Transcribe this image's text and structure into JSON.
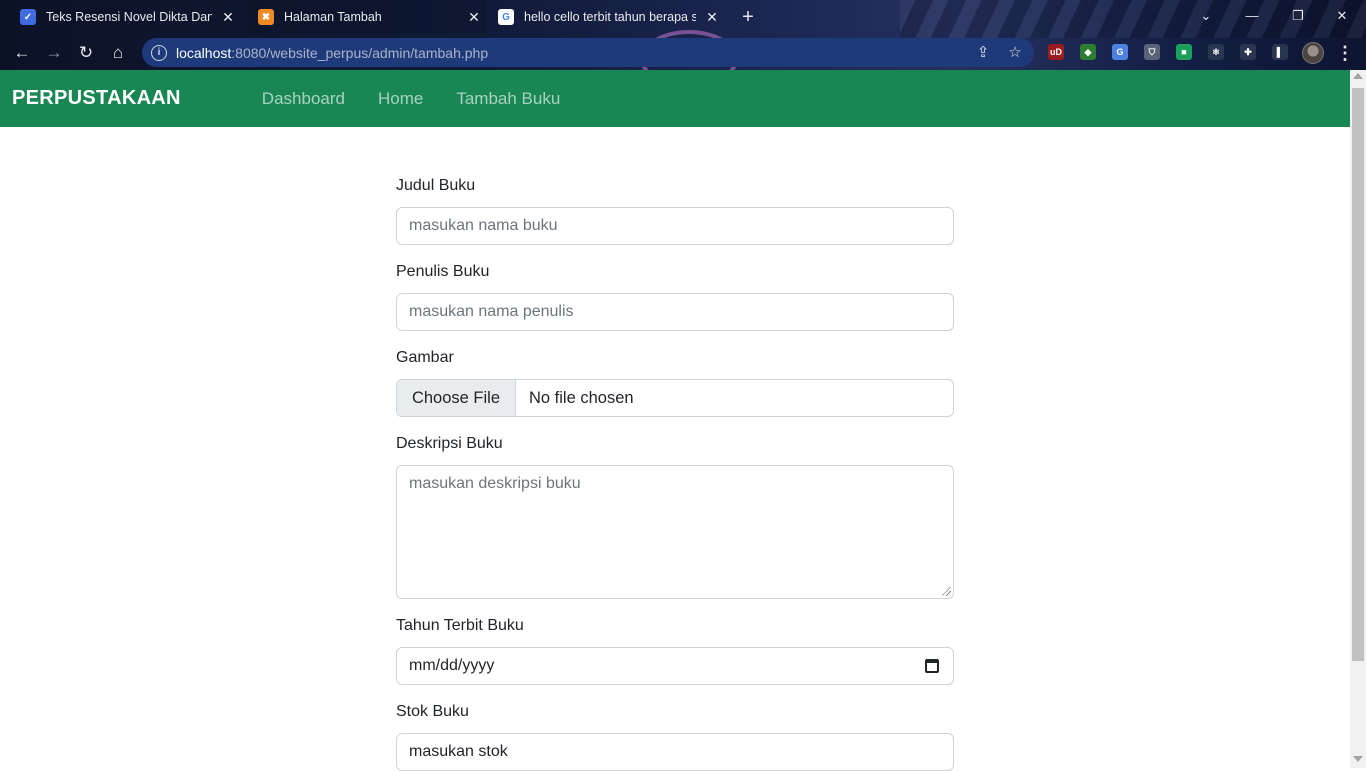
{
  "browser": {
    "tabs": [
      {
        "title": "Teks Resensi Novel Dikta Dan Hukum",
        "icon": "tab-favicon-blue"
      },
      {
        "title": "Halaman Tambah",
        "icon": "xampp-favicon"
      },
      {
        "title": "hello cello terbit tahun berapa sih",
        "icon": "google-favicon"
      }
    ],
    "tab_close_glyph": "✕",
    "new_tab_glyph": "+",
    "window_controls": {
      "collapse": "⌄",
      "minimize": "—",
      "restore": "❐",
      "close": "✕"
    },
    "nav": {
      "back": "←",
      "forward": "→",
      "reload": "↻",
      "home": "⌂"
    },
    "address": {
      "host": "localhost",
      "path": ":8080/website_perpus/admin/tambah.php",
      "info_glyph": "i"
    },
    "address_icons": {
      "share": "⇪",
      "bookmark": "☆"
    },
    "extensions": [
      {
        "name": "ublock-origin-icon",
        "label": "uD",
        "color": "#9a1d1d"
      },
      {
        "name": "extension-green-icon",
        "label": "◆",
        "color": "#2f7d32"
      },
      {
        "name": "google-translate-icon",
        "label": "G",
        "color": "#4c80e3"
      },
      {
        "name": "shield-extension-icon",
        "label": "⛉",
        "color": "#5a6478"
      },
      {
        "name": "green-extension-icon",
        "label": "■",
        "color": "#1aa05a"
      },
      {
        "name": "react-devtools-icon",
        "label": "⚛",
        "color": "#2a3550"
      },
      {
        "name": "puzzle-extensions-icon",
        "label": "✚",
        "color": "#2a3550"
      },
      {
        "name": "side-panel-icon",
        "label": "▌",
        "color": "#2a3550"
      }
    ],
    "menu_glyph": "⋮"
  },
  "navbar": {
    "brand": "PERPUSTAKAAN",
    "links": [
      "Dashboard",
      "Home",
      "Tambah Buku"
    ],
    "color": "#198754"
  },
  "form": {
    "judul": {
      "label": "Judul Buku",
      "placeholder": "masukan nama buku"
    },
    "penulis": {
      "label": "Penulis Buku",
      "placeholder": "masukan nama penulis"
    },
    "gambar": {
      "label": "Gambar",
      "button": "Choose File",
      "status": "No file chosen"
    },
    "deskripsi": {
      "label": "Deskripsi Buku",
      "placeholder": "masukan deskripsi buku"
    },
    "tahun": {
      "label": "Tahun Terbit Buku",
      "value": "mm/dd/yyyy"
    },
    "stok": {
      "label": "Stok Buku",
      "placeholder": "masukan stok"
    }
  }
}
